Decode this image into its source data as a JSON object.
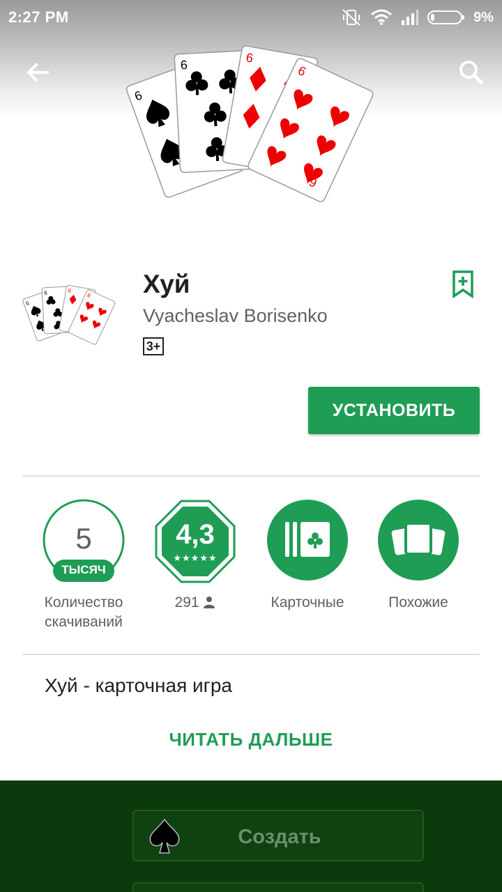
{
  "status_bar": {
    "time": "2:27 PM",
    "battery": "9%"
  },
  "app": {
    "title": "Хуй",
    "developer": "Vyacheslav Borisenko",
    "age_rating": "3+",
    "install_label": "УСТАНОВИТЬ"
  },
  "stats": {
    "downloads": {
      "number": "5",
      "unit": "ТЫСЯЧ",
      "label_line1": "Количество",
      "label_line2": "скачиваний"
    },
    "rating": {
      "value": "4,3",
      "count": "291"
    },
    "category": {
      "label": "Карточные"
    },
    "similar": {
      "label": "Похожие"
    }
  },
  "description": {
    "text": "Хуй - карточная игра",
    "read_more": "ЧИТАТЬ ДАЛЬШЕ"
  },
  "screenshot": {
    "create_label": "Создать"
  },
  "colors": {
    "accent": "#1f9d55",
    "screenshot_bg": "#0d3a0d"
  }
}
